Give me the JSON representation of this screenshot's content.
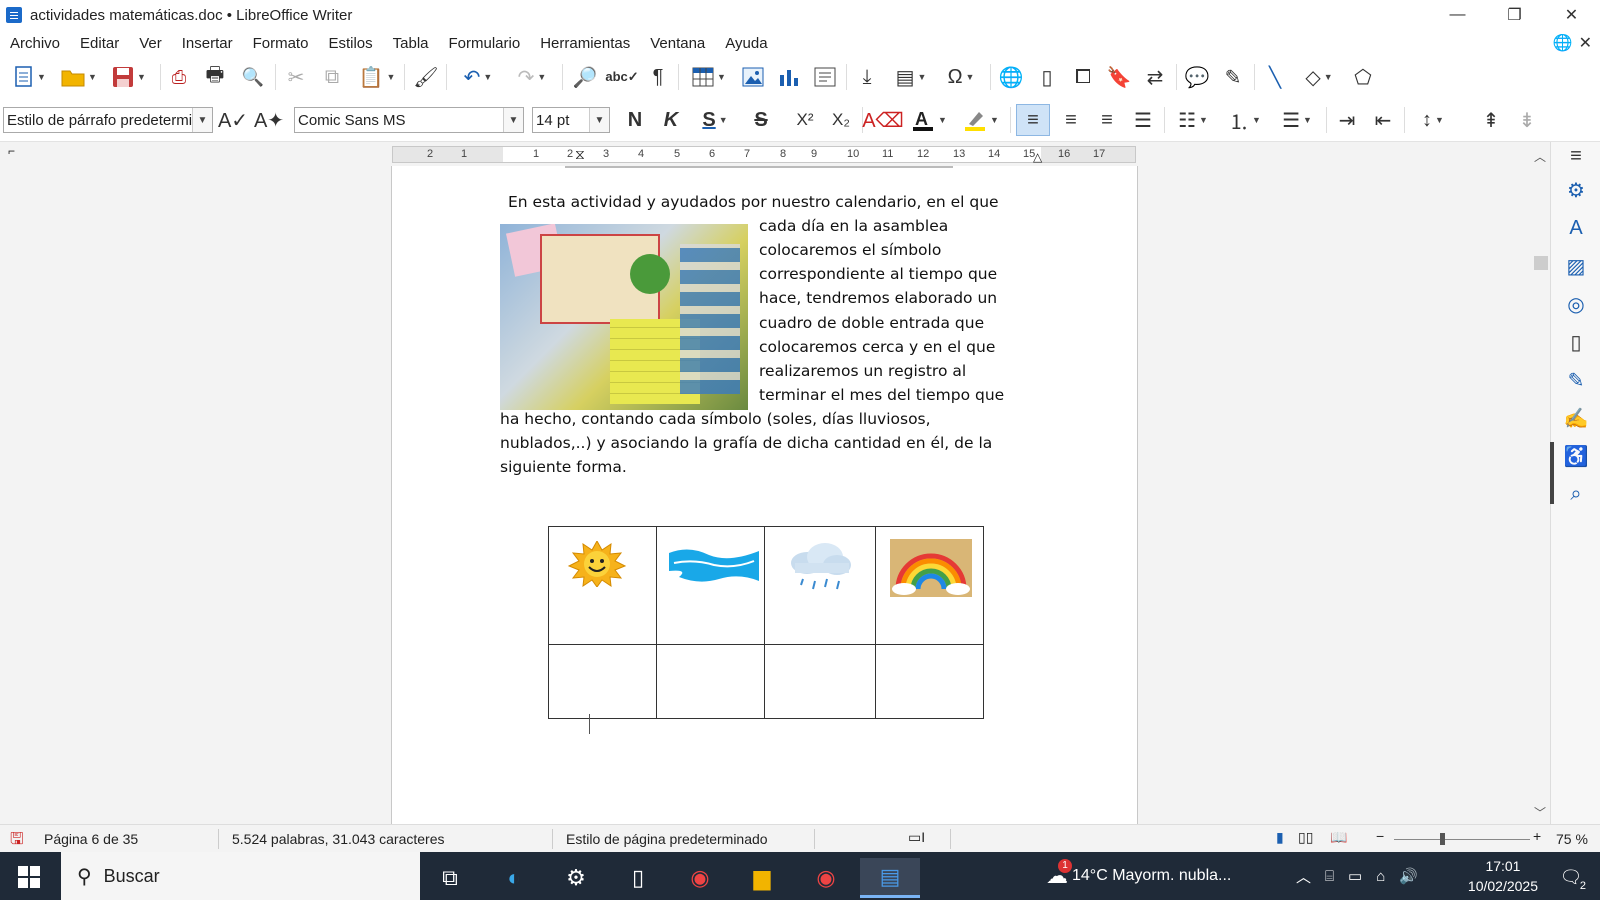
{
  "window": {
    "title": "actividades matemáticas.doc • LibreOffice Writer",
    "minimize": "—",
    "restore": "❐",
    "close": "✕"
  },
  "menu": [
    "Archivo",
    "Editar",
    "Ver",
    "Insertar",
    "Formato",
    "Estilos",
    "Tabla",
    "Formulario",
    "Herramientas",
    "Ventana",
    "Ayuda"
  ],
  "toolbar": {
    "paragraph_style": "Estilo de párrafo predeterminado",
    "font_name": "Comic Sans MS",
    "font_size": "14 pt",
    "bold": "N",
    "italic": "K",
    "underline": "S",
    "strike": "S",
    "superscript": "X²",
    "subscript": "X₂"
  },
  "ruler": {
    "numbers": [
      "2",
      "1",
      "1",
      "2",
      "3",
      "4",
      "5",
      "6",
      "7",
      "8",
      "9",
      "10",
      "11",
      "12",
      "13",
      "14",
      "15",
      "16",
      "17"
    ]
  },
  "document": {
    "lines": [
      "En esta actividad y ayudados por nuestro calendario, en el que",
      "cada día en la asamblea",
      "colocaremos el símbolo",
      "correspondiente al tiempo que",
      "hace, tendremos elaborado un",
      "cuadro de doble entrada que",
      "colocaremos cerca y en el que",
      "realizaremos un registro al",
      "terminar el mes del tiempo que",
      "ha hecho, contando cada símbolo (soles, días lluviosos,",
      "nublados,..) y asociando la grafía de dicha cantidad en él, de la",
      "siguiente forma."
    ]
  },
  "statusbar": {
    "page": "Página 6 de 35",
    "words": "5.524 palabras, 31.043 caracteres",
    "page_style": "Estilo de página predeterminado",
    "zoom": "75 %"
  },
  "taskbar": {
    "search_placeholder": "Buscar",
    "weather": "14°C  Mayorm. nubla...",
    "time": "17:01",
    "date": "10/02/2025",
    "notifications": "2",
    "weather_badge": "1"
  }
}
